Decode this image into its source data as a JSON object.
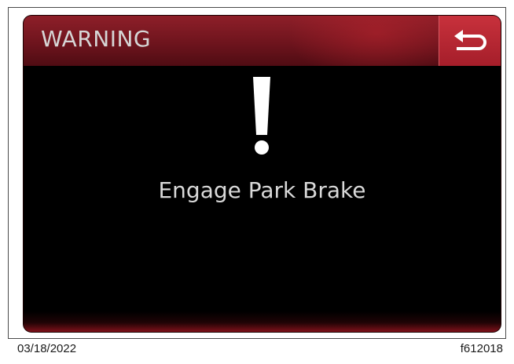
{
  "header": {
    "title": "WARNING",
    "back_icon": "back-arrow-icon"
  },
  "alert": {
    "icon": "exclamation-icon",
    "message": "Engage Park Brake"
  },
  "footer": {
    "date": "03/18/2022",
    "figure_id": "f612018"
  },
  "colors": {
    "header_red": "#8e1f29",
    "button_red": "#b82834",
    "screen_bg": "#000000",
    "text": "#d9d9d9"
  }
}
